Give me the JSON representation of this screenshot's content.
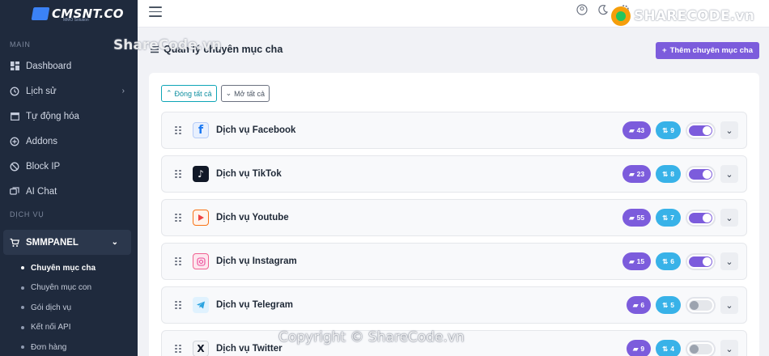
{
  "brand": {
    "logo_text": "CMSNT.CO",
    "logo_sub": "MMO Solution"
  },
  "sidebar": {
    "section_main": "MAIN",
    "main_items": [
      {
        "label": "Dashboard",
        "icon": "dashboard-icon"
      },
      {
        "label": "Lịch sử",
        "icon": "history-icon",
        "has_chevron": true
      },
      {
        "label": "Tự động hóa",
        "icon": "calendar-icon"
      },
      {
        "label": "Addons",
        "icon": "plus-circle-icon"
      },
      {
        "label": "Block IP",
        "icon": "block-icon"
      },
      {
        "label": "AI Chat",
        "icon": "chat-icon"
      }
    ],
    "section_services": "DỊCH VỤ",
    "smm": {
      "label": "SMMPANEL",
      "icon": "cart-icon"
    },
    "sub_items": [
      "Chuyên mục cha",
      "Chuyên mục con",
      "Gói dịch vụ",
      "Kết nối API",
      "Đơn hàng"
    ]
  },
  "page": {
    "title": "Quản lý chuyên mục cha",
    "add_button": "Thêm chuyên mục cha"
  },
  "toolbar": {
    "collapse_all": "Đóng tất cả",
    "expand_all": "Mở tất cả"
  },
  "categories": [
    {
      "name": "Dịch vụ Facebook",
      "icon": "facebook-icon",
      "folders": "43",
      "sort": "9",
      "enabled": true
    },
    {
      "name": "Dịch vụ TikTok",
      "icon": "tiktok-icon",
      "folders": "23",
      "sort": "8",
      "enabled": true
    },
    {
      "name": "Dịch vụ Youtube",
      "icon": "youtube-icon",
      "folders": "55",
      "sort": "7",
      "enabled": true
    },
    {
      "name": "Dịch vụ Instagram",
      "icon": "instagram-icon",
      "folders": "15",
      "sort": "6",
      "enabled": true
    },
    {
      "name": "Dịch vụ Telegram",
      "icon": "telegram-icon",
      "folders": "6",
      "sort": "5",
      "enabled": false
    },
    {
      "name": "Dịch vụ Twitter",
      "icon": "twitter-x-icon",
      "folders": "9",
      "sort": "4",
      "enabled": false
    }
  ],
  "watermark": {
    "top_right": "SHARECODE.vn",
    "middle": "ShareCode.vn",
    "bottom": "Copyright © ShareCode.vn"
  },
  "colors": {
    "sidebar_bg": "#1f2a3d",
    "accent_purple": "#7c5cdc",
    "accent_blue": "#38b2e8"
  }
}
